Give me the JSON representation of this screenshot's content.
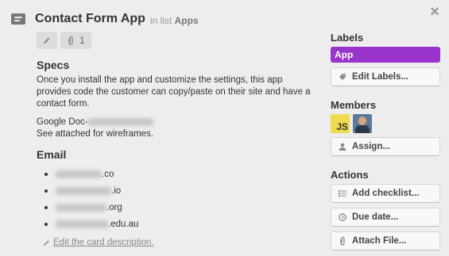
{
  "card": {
    "title": "Contact Form App",
    "in_list_prefix": "in list",
    "list_name": "Apps",
    "attachment_count": "1"
  },
  "description": {
    "heading": "Specs",
    "body": "Once you install the app and customize the settings, this app provides code the customer can copy/paste on their site and have a contact form.",
    "doc_label": "Google Doc-",
    "wireframes": "See attached for wireframes."
  },
  "email": {
    "heading": "Email",
    "items": [
      ".co",
      ".io",
      ".org",
      ".edu.au"
    ]
  },
  "edit_description": "Edit the card description.",
  "sidebar": {
    "labels_heading": "Labels",
    "label_app": "App",
    "label_app_color": "#9933cc",
    "edit_labels": "Edit Labels...",
    "members_heading": "Members",
    "member_js": "JS",
    "assign": "Assign...",
    "actions_heading": "Actions",
    "add_checklist": "Add checklist...",
    "due_date": "Due date...",
    "attach_file": "Attach File..."
  },
  "icons": {
    "close": "close-icon",
    "card": "card-icon",
    "pencil": "pencil-icon",
    "paperclip": "paperclip-icon",
    "tag": "tag-icon",
    "person": "person-icon",
    "checklist": "checklist-icon",
    "clock": "clock-icon"
  }
}
